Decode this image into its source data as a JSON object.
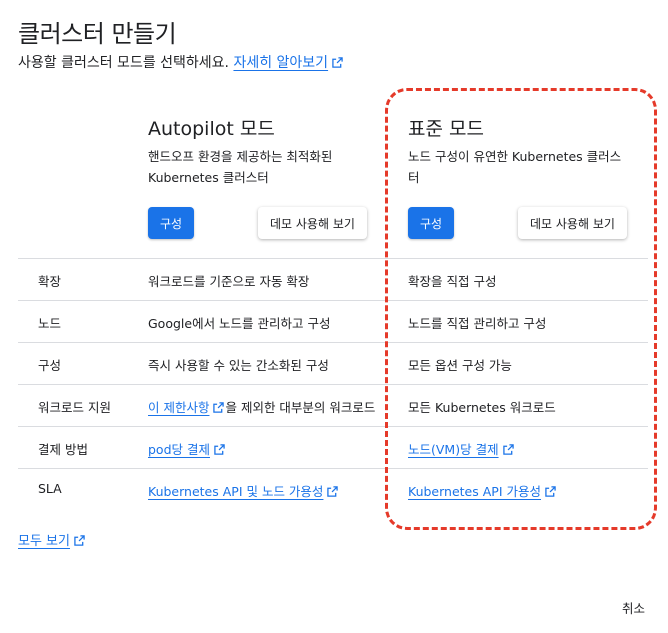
{
  "dialog": {
    "title": "클러스터 만들기",
    "subtitle_text": "사용할 클러스터 모드를 선택하세요.",
    "learn_more_label": "자세히 알아보기"
  },
  "autopilot": {
    "heading": "Autopilot 모드",
    "description": "핸드오프 환경을 제공하는 최적화된 Kubernetes 클러스터",
    "configure_label": "구성",
    "demo_label": "데모 사용해 보기"
  },
  "standard": {
    "heading": "표준 모드",
    "description": "노드 구성이 유연한 Kubernetes 클러스터",
    "configure_label": "구성",
    "demo_label": "데모 사용해 보기"
  },
  "comparison": {
    "rows": [
      {
        "feature": "확장",
        "autopilot": "워크로드를 기준으로 자동 확장",
        "standard": "확장을 직접 구성"
      },
      {
        "feature": "노드",
        "autopilot": "Google에서 노드를 관리하고 구성",
        "standard": "노드를 직접 관리하고 구성"
      },
      {
        "feature": "구성",
        "autopilot": "즉시 사용할 수 있는 간소화된 구성",
        "standard": "모든 옵션 구성 가능"
      },
      {
        "feature": "워크로드 지원",
        "autopilot_link": "이 제한사항",
        "autopilot_suffix": "을 제외한 대부분의 워크로드",
        "standard": "모든 Kubernetes 워크로드"
      },
      {
        "feature": "결제 방법",
        "autopilot_link": "pod당 결제",
        "standard_link": "노드(VM)당 결제"
      },
      {
        "feature": "SLA",
        "autopilot_link": "Kubernetes API 및 노드 가용성",
        "standard_link": "Kubernetes API 가용성"
      }
    ]
  },
  "footer": {
    "view_all_label": "모두 보기",
    "cancel_label": "취소"
  },
  "colors": {
    "accent": "#1a73e8",
    "highlight_border": "#e53a2a",
    "divider": "#dadce0"
  },
  "icons": {
    "external_link": "open-in-new-icon"
  }
}
